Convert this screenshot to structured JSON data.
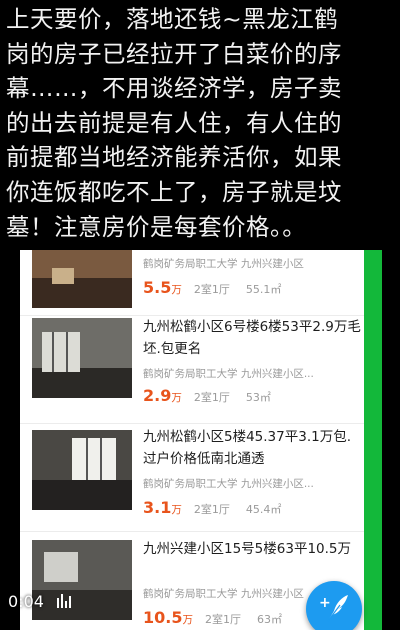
{
  "post": {
    "lines": [
      "上天要价，落地还钱~黑龙江鹤",
      "岗的房子已经拉开了白菜价的序",
      "幕……，不用谈经济学，房子卖",
      "的出去前提是有人住，有人住的",
      "前提都当地经济能养活你，如果",
      "你连饭都吃不上了，房子就是坟",
      "墓！注意房价是每套价格。。"
    ]
  },
  "listings": [
    {
      "title": "",
      "meta": "鹤岗矿务局职工大学   九州兴建小区",
      "price": "5.5",
      "price_unit": "万",
      "layout": "2室1厅",
      "area": "55.1㎡"
    },
    {
      "title": "九州松鹤小区6号楼6楼53平2.9万毛坯.包更名",
      "meta": "鹤岗矿务局职工大学   九州兴建小区...",
      "price": "2.9",
      "price_unit": "万",
      "layout": "2室1厅",
      "area": "53㎡"
    },
    {
      "title": "九州松鹤小区5楼45.37平3.1万包.过户价格低南北通透",
      "meta": "鹤岗矿务局职工大学   九州兴建小区...",
      "price": "3.1",
      "price_unit": "万",
      "layout": "2室1厅",
      "area": "45.4㎡"
    },
    {
      "title": "九州兴建小区15号5楼63平10.5万",
      "meta": "鹤岗矿务局职工大学   九州兴建小区",
      "price": "10.5",
      "price_unit": "万",
      "layout": "2室1厅",
      "area": "63㎡"
    }
  ],
  "video": {
    "timestamp": "0:04"
  },
  "fab": {
    "plus": "+"
  },
  "colors": {
    "price": "#e8541c",
    "accent_green": "#13b83a",
    "fab_blue": "#1d9bf0"
  },
  "icons": [
    "volume-bars-icon",
    "compose-feather-icon"
  ]
}
